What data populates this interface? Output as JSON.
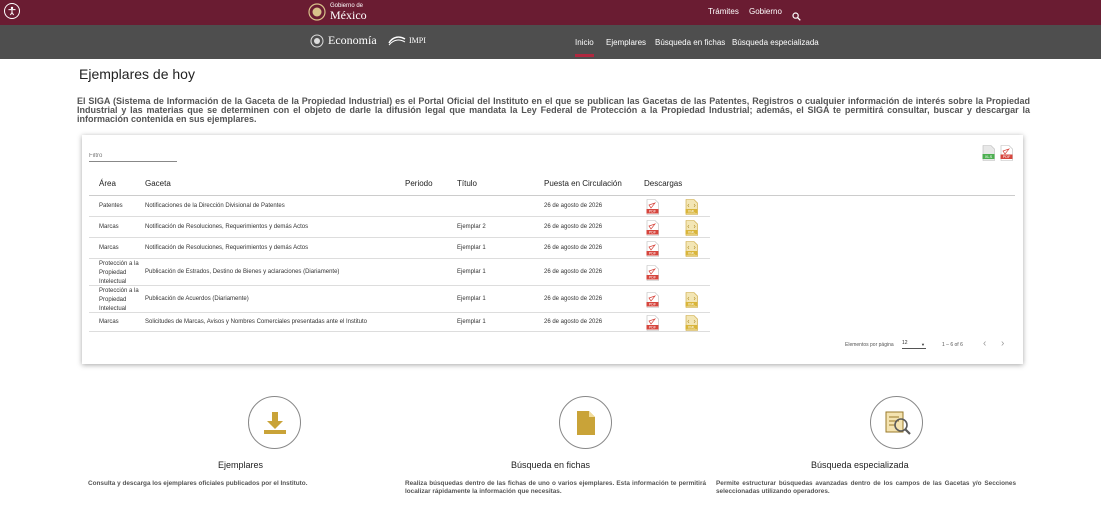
{
  "header": {
    "gov_small": "Gobierno de",
    "gov_big": "México",
    "top_links": [
      "Trámites",
      "Gobierno"
    ],
    "economia": "Economía",
    "impi": "IMPI",
    "nav": [
      "Inicio",
      "Ejemplares",
      "Búsqueda en fichas",
      "Búsqueda especializada"
    ]
  },
  "page": {
    "title": "Ejemplares de hoy",
    "intro": "El SIGA (Sistema de Información de la Gaceta de la Propiedad Industrial) es el Portal Oficial del Instituto en el que se publican las Gacetas de las Patentes, Registros o cualquier información de interés sobre la Propiedad Industrial y las materias que se determinen con el objeto de darle la difusión legal que mandata la Ley Federal de Protección a la Propiedad Industrial; además, el SIGA te permitirá consultar, buscar y descargar la información contenida en sus ejemplares."
  },
  "table": {
    "filter_placeholder": "Filtro",
    "headers": [
      "Área",
      "Gaceta",
      "Periodo",
      "Título",
      "Puesta en Circulación",
      "Descargas"
    ],
    "rows": [
      {
        "area": "Patentes",
        "gaceta": "Notificaciones de la Dirección Divisional de Patentes",
        "periodo": "",
        "titulo": "",
        "fecha": "26 de agosto de 2026",
        "xml": true
      },
      {
        "area": "Marcas",
        "gaceta": "Notificación de Resoluciones, Requerimientos y demás Actos",
        "periodo": "",
        "titulo": "Ejemplar 2",
        "fecha": "26 de agosto de 2026",
        "xml": true
      },
      {
        "area": "Marcas",
        "gaceta": "Notificación de Resoluciones, Requerimientos y demás Actos",
        "periodo": "",
        "titulo": "Ejemplar 1",
        "fecha": "26 de agosto de 2026",
        "xml": true
      },
      {
        "area": "Protección a la Propiedad Intelectual",
        "gaceta": "Publicación de Estrados, Destino de Bienes y aclaraciones (Diariamente)",
        "periodo": "",
        "titulo": "Ejemplar 1",
        "fecha": "26 de agosto de 2026",
        "xml": false
      },
      {
        "area": "Protección a la Propiedad Intelectual",
        "gaceta": "Publicación de Acuerdos (Diariamente)",
        "periodo": "",
        "titulo": "Ejemplar 1",
        "fecha": "26 de agosto de 2026",
        "xml": true
      },
      {
        "area": "Marcas",
        "gaceta": "Solicitudes de Marcas, Avisos y Nombres Comerciales presentadas ante el Instituto",
        "periodo": "",
        "titulo": "Ejemplar 1",
        "fecha": "26 de agosto de 2026",
        "xml": true
      }
    ],
    "pager_label": "Elementos por página",
    "page_size": "12",
    "range": "1 – 6 of 6",
    "pdf_label": "PDF",
    "xml_label": "XML",
    "xls_label": "XLS"
  },
  "features": [
    {
      "title": "Ejemplares",
      "desc": "Consulta y descarga los ejemplares oficiales publicados por el Instituto."
    },
    {
      "title": "Búsqueda en fichas",
      "desc": "Realiza búsquedas dentro de las fichas de uno o varios ejemplares. Esta información te permitirá localizar rápidamente la información que necesitas."
    },
    {
      "title": "Búsqueda especializada",
      "desc": "Permite estructurar búsquedas avanzadas dentro de los campos de las Gacetas y/o Secciones seleccionadas utilizando operadores."
    }
  ],
  "colors": {
    "brand": "#6a1c32",
    "secondary_bar": "#4e4e4e",
    "accent": "#b0283f",
    "icon_gold": "#c9a338",
    "pdf_red": "#d6453d",
    "xml_yellow": "#d9b53a"
  }
}
